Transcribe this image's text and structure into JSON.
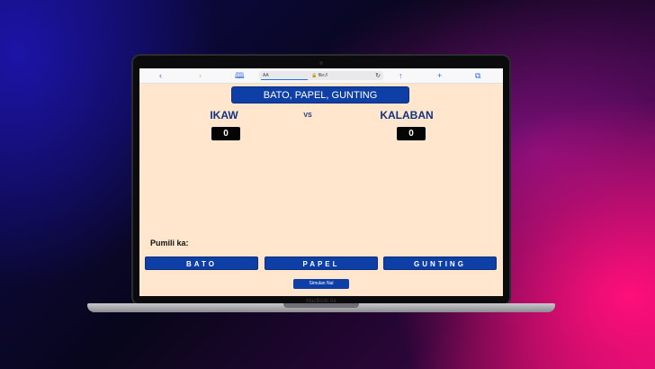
{
  "device": {
    "label": "MacBook Air"
  },
  "browser": {
    "url_prefix": "AA",
    "url": "file://",
    "icons": [
      "back-icon",
      "forward-icon",
      "bookmarks-icon",
      "lock-icon",
      "reload-icon",
      "share-icon",
      "new-tab-icon",
      "tabs-icon"
    ]
  },
  "game": {
    "title": "BATO, PAPEL, GUNTING",
    "player_label": "IKAW",
    "vs_label": "VS",
    "cpu_label": "KALABAN",
    "player_score": "0",
    "cpu_score": "0",
    "prompt": "Pumili ka:",
    "choices": [
      "BATO",
      "PAPEL",
      "GUNTING"
    ],
    "restart_label": "Simulan Nal"
  },
  "colors": {
    "accent": "#0e3fa6",
    "page_bg": "#ffe6cd",
    "label_text": "#12327f"
  }
}
